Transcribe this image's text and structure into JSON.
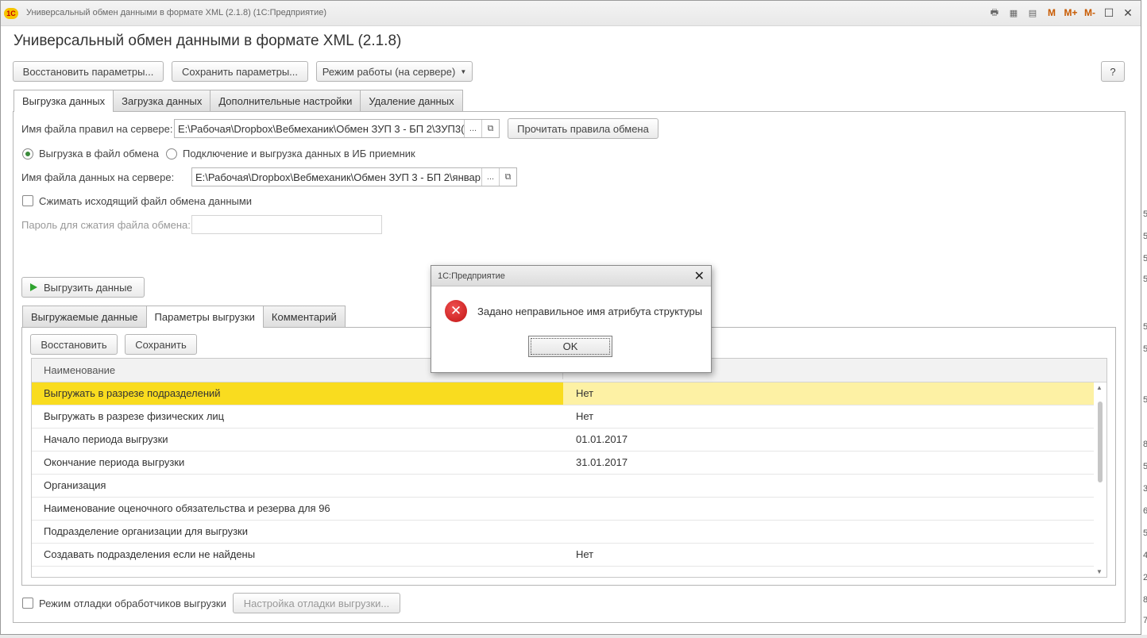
{
  "window": {
    "title": "Универсальный обмен данными в формате XML (2.1.8)  (1С:Предприятие)",
    "logo_text": "1С",
    "toolbar_right": [
      "M",
      "M+",
      "M-"
    ]
  },
  "form": {
    "title": "Универсальный обмен данными в формате XML (2.1.8)",
    "top_buttons": {
      "restore": "Восстановить параметры...",
      "save": "Сохранить параметры...",
      "mode": "Режим работы (на сервере)",
      "help": "?"
    },
    "main_tabs": [
      "Выгрузка данных",
      "Загрузка данных",
      "Дополнительные настройки",
      "Удаление данных"
    ],
    "rules_file": {
      "label": "Имя файла правил на сервере:",
      "value": "E:\\Рабочая\\Dropbox\\Вебмеханик\\Обмен ЗУП 3 - БП 2\\ЗУП3(",
      "read_button": "Прочитать правила обмена"
    },
    "export_mode": {
      "option1": "Выгрузка в файл обмена",
      "option2": "Подключение и выгрузка данных в ИБ приемник",
      "selected": "option1"
    },
    "data_file": {
      "label": "Имя файла данных на сервере:",
      "value": "E:\\Рабочая\\Dropbox\\Вебмеханик\\Обмен ЗУП 3 - БП 2\\январ"
    },
    "compress": {
      "label": "Сжимать исходящий файл обмена данными",
      "checked": false
    },
    "password": {
      "label": "Пароль для сжатия файла обмена:",
      "value": ""
    },
    "export_button": "Выгрузить данные",
    "sub_tabs": [
      "Выгружаемые данные",
      "Параметры выгрузки",
      "Комментарий"
    ],
    "sub_buttons": {
      "restore": "Восстановить",
      "save": "Сохранить"
    },
    "grid": {
      "header": "Наименование",
      "rows": [
        {
          "name": "Выгружать в разрезе подразделений",
          "value": "Нет",
          "selected": true
        },
        {
          "name": "Выгружать в разрезе физических лиц",
          "value": "Нет"
        },
        {
          "name": "Начало периода выгрузки",
          "value": "01.01.2017"
        },
        {
          "name": "Окончание периода выгрузки",
          "value": "31.01.2017"
        },
        {
          "name": "Организация",
          "value": ""
        },
        {
          "name": "Наименование оценочного обязательства и резерва для 96",
          "value": ""
        },
        {
          "name": "Подразделение организации для выгрузки",
          "value": ""
        },
        {
          "name": "Создавать подразделения если не найдены",
          "value": "Нет"
        }
      ]
    },
    "debug": {
      "label": "Режим отладки обработчиков выгрузки",
      "checked": false,
      "settings_button": "Настройка отладки выгрузки..."
    }
  },
  "dialog": {
    "title": "1С:Предприятие",
    "message": "Задано неправильное имя атрибута структуры",
    "ok": "OK"
  },
  "side_digits": [
    "5",
    "5",
    "5",
    "5",
    "5",
    "5",
    "5",
    "8",
    "5",
    "3",
    "6",
    "5",
    "4",
    "2",
    "8",
    "7"
  ]
}
